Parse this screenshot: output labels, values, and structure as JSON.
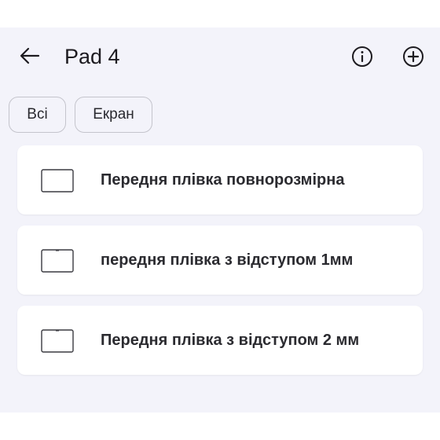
{
  "header": {
    "title": "Pad 4",
    "back_icon": "arrow-left-icon",
    "info_icon": "info-circle-icon",
    "add_icon": "plus-circle-icon"
  },
  "filters": {
    "chips": [
      {
        "label": "Всі"
      },
      {
        "label": "Екран"
      }
    ]
  },
  "items": [
    {
      "label": "Передня плівка повнорозмірна",
      "icon": "screen-film-full-icon"
    },
    {
      "label": "передня плівка з відступом 1мм",
      "icon": "screen-film-notch-icon"
    },
    {
      "label": "Передня плівка з відступом 2 мм",
      "icon": "screen-film-notch-icon"
    }
  ],
  "colors": {
    "background": "#f3f3fa",
    "card": "#ffffff",
    "text": "#1d1b20"
  }
}
